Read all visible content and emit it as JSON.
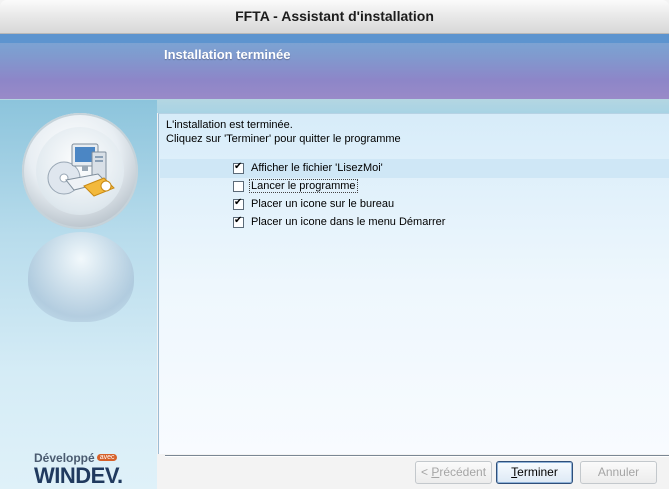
{
  "window": {
    "title": "FFTA - Assistant d'installation"
  },
  "header": {
    "title": "Installation terminée"
  },
  "message": {
    "line1": "L'installation est terminée.",
    "line2": "Cliquez sur 'Terminer' pour quitter le programme"
  },
  "options": [
    {
      "label": "Afficher le fichier 'LisezMoi'",
      "checked": true
    },
    {
      "label": "Lancer le programme",
      "checked": false
    },
    {
      "label": "Placer un icone sur le bureau",
      "checked": true
    },
    {
      "label": "Placer un icone dans le menu Démarrer",
      "checked": true
    }
  ],
  "branding": {
    "small": "Développé",
    "avec": "avec",
    "big": "WINDEV."
  },
  "buttons": {
    "previous": {
      "prefix": "< ",
      "mnemonic": "P",
      "rest": "récédent",
      "enabled": false
    },
    "finish": {
      "mnemonic": "T",
      "rest": "erminer",
      "enabled": true
    },
    "cancel": {
      "label": "Annuler",
      "enabled": false
    }
  },
  "colors": {
    "header_top": "#5d94cf",
    "header_mid": "#8d86c8",
    "content_bg": "#eef7fd",
    "left_panel": "#b8dcec"
  }
}
